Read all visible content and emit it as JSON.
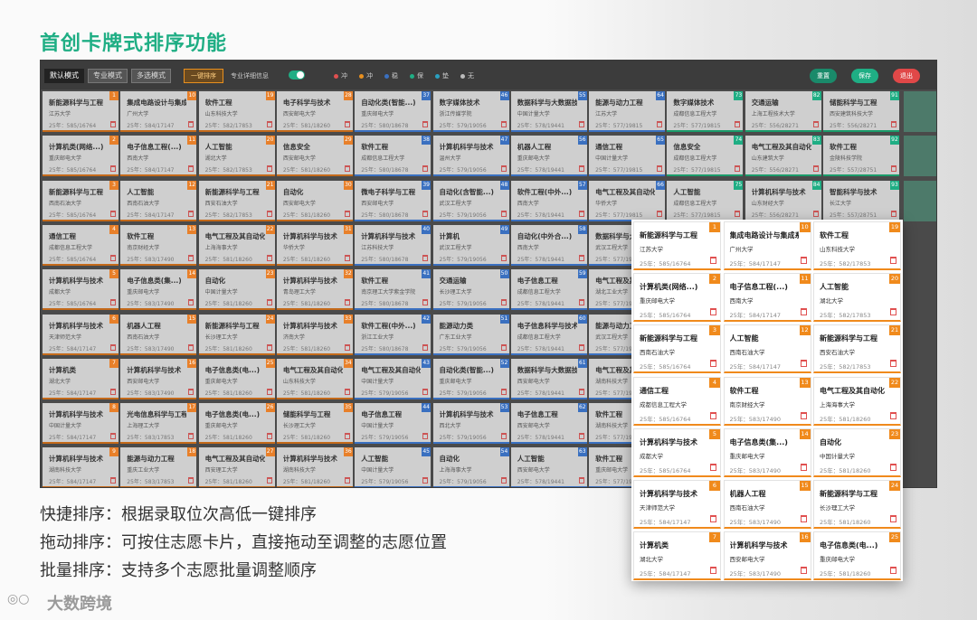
{
  "title": "首创卡牌式排序功能",
  "toolbar": {
    "mode_tabs": [
      "默认模式",
      "专业模式",
      "多选模式"
    ],
    "sort_btn": "一键排序",
    "detail_label": "专业详细信息",
    "legend": [
      {
        "label": "冲",
        "color": "#e05050"
      },
      {
        "label": "冲",
        "color": "#e8901f"
      },
      {
        "label": "稳",
        "color": "#3a70c0"
      },
      {
        "label": "保",
        "color": "#1fae84"
      },
      {
        "label": "垫",
        "color": "#2aa0c0"
      },
      {
        "label": "无",
        "color": "#bbbbbb"
      }
    ],
    "actions": [
      {
        "label": "重置",
        "color": "#1a8a6a"
      },
      {
        "label": "保存",
        "color": "#1fae84"
      },
      {
        "label": "退出",
        "color": "#e04848"
      }
    ]
  },
  "background_cards": [
    [
      "新能源科学与工程",
      "江苏大学",
      "25年：585/16764",
      "1"
    ],
    [
      "集成电路设计与集成系统",
      "广州大学",
      "25年：584/17147",
      "10"
    ],
    [
      "软件工程",
      "山东科技大学",
      "25年：582/17853",
      "19"
    ],
    [
      "电子科学与技术",
      "西安邮电大学",
      "25年：581/18260",
      "28"
    ],
    [
      "自动化类(智能...)",
      "重庆邮电大学",
      "25年：580/18678",
      "37"
    ],
    [
      "数字媒体技术",
      "浙江传媒学院",
      "25年：579/19056",
      "46"
    ],
    [
      "数据科学与大数据技术",
      "中国计量大学",
      "25年：578/19441",
      "55"
    ],
    [
      "能源与动力工程",
      "江苏大学",
      "25年：577/19815",
      "64"
    ],
    [
      "数字媒体技术",
      "成都信息工程大学",
      "25年：577/19815",
      "73"
    ],
    [
      "交通运输",
      "上海工程技术大学",
      "25年：556/28271",
      "82"
    ],
    [
      "储能科学与工程",
      "西安建筑科技大学",
      "25年：556/28271",
      "91"
    ],
    [
      "计算机类(网络...)",
      "重庆邮电大学",
      "25年：585/16764",
      "2"
    ],
    [
      "电子信息工程(...)",
      "西南大学",
      "25年：584/17147",
      "11"
    ],
    [
      "人工智能",
      "湖北大学",
      "25年：582/17853",
      "20"
    ],
    [
      "信息安全",
      "西安邮电大学",
      "25年：581/18260",
      "29"
    ],
    [
      "软件工程",
      "成都信息工程大学",
      "25年：580/18678",
      "38"
    ],
    [
      "计算机科学与技术",
      "温州大学",
      "25年：579/19056",
      "47"
    ],
    [
      "机器人工程",
      "重庆邮电大学",
      "25年：578/19441",
      "56"
    ],
    [
      "通信工程",
      "中国计量大学",
      "25年：577/19815",
      "65"
    ],
    [
      "信息安全",
      "成都信息工程大学",
      "25年：577/19815",
      "74"
    ],
    [
      "电气工程及其自动化",
      "山东建筑大学",
      "25年：556/28271",
      "83"
    ],
    [
      "软件工程",
      "金陵科技学院",
      "25年：557/28751",
      "92"
    ],
    [
      "新能源科学与工程",
      "西南石油大学",
      "25年：585/16764",
      "3"
    ],
    [
      "人工智能",
      "西南石油大学",
      "25年：584/17147",
      "12"
    ],
    [
      "新能源科学与工程",
      "西安石油大学",
      "25年：582/17853",
      "21"
    ],
    [
      "自动化",
      "西安邮电大学",
      "25年：581/18260",
      "30"
    ],
    [
      "微电子科学与工程",
      "西安邮电大学",
      "25年：580/18678",
      "39"
    ],
    [
      "自动化(含智能...)",
      "武汉工程大学",
      "25年：579/19056",
      "48"
    ],
    [
      "软件工程(中外...)",
      "西南大学",
      "25年：578/19441",
      "57"
    ],
    [
      "电气工程及其自动化",
      "华侨大学",
      "25年：577/19815",
      "66"
    ],
    [
      "人工智能",
      "成都信息工程大学",
      "25年：577/19815",
      "75"
    ],
    [
      "计算机科学与技术",
      "山东财经大学",
      "25年：556/28271",
      "84"
    ],
    [
      "智能科学与技术",
      "长江大学",
      "25年：557/28751",
      "93"
    ],
    [
      "通信工程",
      "成都信息工程大学",
      "25年：585/16764",
      "4"
    ],
    [
      "软件工程",
      "南京财经大学",
      "25年：583/17490",
      "13"
    ],
    [
      "电气工程及其自动化",
      "上海海事大学",
      "25年：581/18260",
      "22"
    ],
    [
      "计算机科学与技术",
      "华侨大学",
      "25年：581/18260",
      "31"
    ],
    [
      "计算机科学与技术",
      "江苏科技大学",
      "25年：580/18678",
      "40"
    ],
    [
      "计算机",
      "武汉工程大学",
      "25年：579/19056",
      "49"
    ],
    [
      "自动化(中外合...)",
      "西南大学",
      "25年：578/19441",
      "58"
    ],
    [
      "数据科学与大数据技术",
      "武汉工程大学",
      "25年：577/19815",
      "67"
    ],
    [
      "计算机科学与技术",
      "成都大学",
      "25年：585/16764",
      "5"
    ],
    [
      "电子信息类(集...)",
      "重庆邮电大学",
      "25年：583/17490",
      "14"
    ],
    [
      "自动化",
      "中国计量大学",
      "25年：581/18260",
      "23"
    ],
    [
      "计算机科学与技术",
      "青岛理工大学",
      "25年：581/18260",
      "32"
    ],
    [
      "软件工程",
      "南京理工大学紫金学院",
      "25年：580/18678",
      "41"
    ],
    [
      "交通运输",
      "长沙理工大学",
      "25年：579/19056",
      "50"
    ],
    [
      "电子信息工程",
      "成都信息工程大学",
      "25年：578/19441",
      "59"
    ],
    [
      "电气工程及其自动化",
      "湖北工业大学",
      "25年：577/19815",
      "68"
    ],
    [
      "计算机科学与技术",
      "天津师范大学",
      "25年：584/17147",
      "6"
    ],
    [
      "机器人工程",
      "西南石油大学",
      "25年：583/17490",
      "15"
    ],
    [
      "新能源科学与工程",
      "长沙理工大学",
      "25年：581/18260",
      "24"
    ],
    [
      "计算机科学与技术",
      "济南大学",
      "25年：581/18260",
      "33"
    ],
    [
      "软件工程(中外...)",
      "浙江工业大学",
      "25年：580/18678",
      "42"
    ],
    [
      "能源动力类",
      "广东工业大学",
      "25年：579/19056",
      "51"
    ],
    [
      "电子信息科学与技术",
      "成都信息工程大学",
      "25年：578/19441",
      "60"
    ],
    [
      "能源与动力工程",
      "武汉工程大学",
      "25年：577/19815",
      "69"
    ],
    [
      "计算机类",
      "湖北大学",
      "25年：584/17147",
      "7"
    ],
    [
      "计算机科学与技术",
      "西安邮电大学",
      "25年：583/17490",
      "16"
    ],
    [
      "电子信息类(电...)",
      "重庆邮电大学",
      "25年：581/18260",
      "25"
    ],
    [
      "电气工程及其自动化",
      "山东科技大学",
      "25年：581/18260",
      "34"
    ],
    [
      "电气工程及其自动化",
      "中国计量大学",
      "25年：579/19056",
      "43"
    ],
    [
      "自动化类(智能...)",
      "重庆邮电大学",
      "25年：579/19056",
      "52"
    ],
    [
      "数据科学与大数据技术",
      "西安邮电大学",
      "25年：578/19441",
      "61"
    ],
    [
      "电气工程及其自动化",
      "湖南科技大学",
      "25年：577/19815",
      "70"
    ],
    [
      "计算机科学与技术",
      "中国计量大学",
      "25年：584/17147",
      "8"
    ],
    [
      "光电信息科学与工程",
      "上海理工大学",
      "25年：583/17853",
      "17"
    ],
    [
      "电子信息类(电...)",
      "重庆邮电大学",
      "25年：581/18260",
      "26"
    ],
    [
      "储能科学与工程",
      "长沙理工大学",
      "25年：581/18260",
      "35"
    ],
    [
      "电子信息工程",
      "中国计量大学",
      "25年：579/19056",
      "44"
    ],
    [
      "计算机科学与技术",
      "西北大学",
      "25年：579/19056",
      "53"
    ],
    [
      "电子信息工程",
      "西安邮电大学",
      "25年：578/19441",
      "62"
    ],
    [
      "软件工程",
      "湖南科技大学",
      "25年：577/19815",
      "71"
    ],
    [
      "计算机科学与技术",
      "湖南科技大学",
      "25年：584/17147",
      "9"
    ],
    [
      "能源与动力工程",
      "重庆工业大学",
      "25年：583/17853",
      "18"
    ],
    [
      "电气工程及其自动化",
      "西安理工大学",
      "25年：581/18260",
      "27"
    ],
    [
      "计算机科学与技术",
      "湖南科技大学",
      "25年：581/18260",
      "36"
    ],
    [
      "人工智能",
      "中国计量大学",
      "25年：579/19056",
      "45"
    ],
    [
      "自动化",
      "上海海事大学",
      "25年：579/19056",
      "54"
    ],
    [
      "人工智能",
      "西安邮电大学",
      "25年：578/19441",
      "63"
    ],
    [
      "软件工程",
      "重庆邮电大学",
      "25年：577/19815",
      "72"
    ]
  ],
  "zoom_cards": [
    [
      "新能源科学与工程",
      "江苏大学",
      "25年：585/16764",
      "1"
    ],
    [
      "集成电路设计与集成系统",
      "广州大学",
      "25年：584/17147",
      "10"
    ],
    [
      "软件工程",
      "山东科技大学",
      "25年：582/17853",
      "19"
    ],
    [
      "计算机类(网络...)",
      "重庆邮电大学",
      "25年：585/16764",
      "2"
    ],
    [
      "电子信息工程(...)",
      "西南大学",
      "25年：584/17147",
      "11"
    ],
    [
      "人工智能",
      "湖北大学",
      "25年：582/17853",
      "20"
    ],
    [
      "新能源科学与工程",
      "西南石油大学",
      "25年：585/16764",
      "3"
    ],
    [
      "人工智能",
      "西南石油大学",
      "25年：584/17147",
      "12"
    ],
    [
      "新能源科学与工程",
      "西安石油大学",
      "25年：582/17853",
      "21"
    ],
    [
      "通信工程",
      "成都信息工程大学",
      "25年：585/16764",
      "4"
    ],
    [
      "软件工程",
      "南京财经大学",
      "25年：583/17490",
      "13"
    ],
    [
      "电气工程及其自动化",
      "上海海事大学",
      "25年：581/18260",
      "22"
    ],
    [
      "计算机科学与技术",
      "成都大学",
      "25年：585/16764",
      "5"
    ],
    [
      "电子信息类(集...)",
      "重庆邮电大学",
      "25年：583/17490",
      "14"
    ],
    [
      "自动化",
      "中国计量大学",
      "25年：581/18260",
      "23"
    ],
    [
      "计算机科学与技术",
      "天津师范大学",
      "25年：584/17147",
      "6"
    ],
    [
      "机器人工程",
      "西南石油大学",
      "25年：583/17490",
      "15"
    ],
    [
      "新能源科学与工程",
      "长沙理工大学",
      "25年：581/18260",
      "24"
    ],
    [
      "计算机类",
      "湖北大学",
      "25年：584/17147",
      "7"
    ],
    [
      "计算机科学与技术",
      "西安邮电大学",
      "25年：583/17490",
      "16"
    ],
    [
      "电子信息类(电...)",
      "重庆邮电大学",
      "25年：581/18260",
      "25"
    ]
  ],
  "features": [
    "快捷排序：根据录取位次高低一键排序",
    "拖动排序：可按住志愿卡片，直接拖动至调整的志愿位置",
    "批量排序：支持多个志愿批量调整顺序"
  ],
  "logo_text": "大数跨境"
}
